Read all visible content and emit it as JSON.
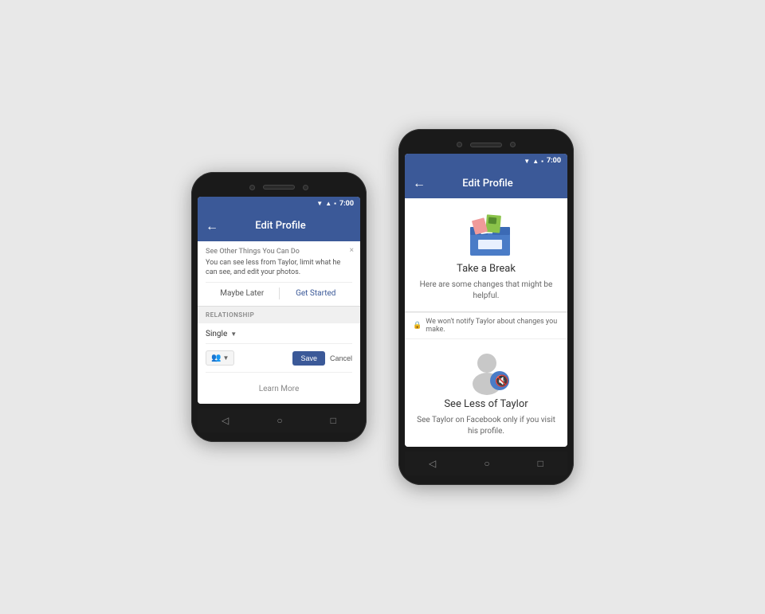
{
  "left_phone": {
    "status_bar": {
      "time": "7:00"
    },
    "app_bar": {
      "back_icon": "←",
      "title": "Edit Profile"
    },
    "notification": {
      "title": "See Other Things You Can Do",
      "text": "You can see less from Taylor, limit what he can see, and edit your photos.",
      "maybe_later": "Maybe Later",
      "get_started": "Get Started",
      "close_icon": "×"
    },
    "relationship": {
      "section_label": "RELATIONSHIP",
      "status": "Single",
      "dropdown_arrow": "▼",
      "people_icon": "👥",
      "save_btn": "Save",
      "cancel_btn": "Cancel",
      "learn_more": "Learn More"
    },
    "nav": {
      "back": "◁",
      "home": "○",
      "square": "□"
    }
  },
  "right_phone": {
    "status_bar": {
      "time": "7:00"
    },
    "app_bar": {
      "back_icon": "←",
      "title": "Edit Profile"
    },
    "take_break": {
      "title": "Take a Break",
      "description": "Here are some changes that might be helpful."
    },
    "privacy_note": {
      "lock_icon": "🔒",
      "text": "We won't notify Taylor about changes you make."
    },
    "see_less": {
      "title": "See Less of Taylor",
      "description": "See Taylor on Facebook only if you visit his profile."
    },
    "nav": {
      "back": "◁",
      "home": "○",
      "square": "□"
    }
  }
}
